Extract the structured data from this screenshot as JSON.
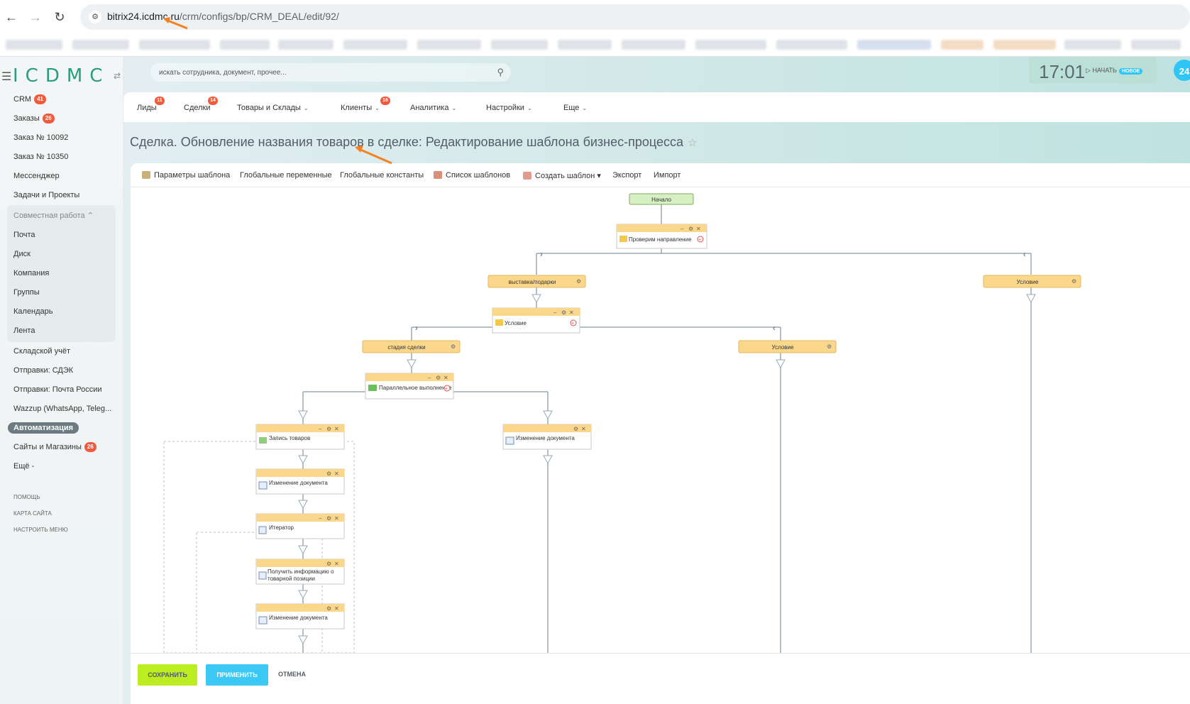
{
  "browser": {
    "url_domain": "bitrix24.icdmc.ru",
    "url_path": "/crm/configs/bp/CRM_DEAL/edit/92/"
  },
  "header": {
    "logo": "ICDMC",
    "search_placeholder": "искать сотрудника, документ, прочее...",
    "clock": "17:01",
    "start_label": "НАЧАТЬ",
    "new_badge": "НОВОЕ",
    "b24_label": "24"
  },
  "sidebar": {
    "items": [
      {
        "label": "CRM",
        "badge": "41"
      },
      {
        "label": "Заказы",
        "badge": "26"
      },
      {
        "label": "Заказ № 10092"
      },
      {
        "label": "Заказ № 10350"
      },
      {
        "label": "Мессенджер"
      },
      {
        "label": "Задачи и Проекты"
      }
    ],
    "group_title": "Совместная работа",
    "group_items": [
      "Почта",
      "Диск",
      "Компания",
      "Группы",
      "Календарь",
      "Лента"
    ],
    "items2": [
      {
        "label": "Складской учёт"
      },
      {
        "label": "Отправки: СДЭК"
      },
      {
        "label": "Отправки: Почта России"
      },
      {
        "label": "Wazzup (WhatsApp, Teleg..."
      },
      {
        "label": "Автоматизация",
        "active": true
      },
      {
        "label": "Сайты и Магазины",
        "badge": "26"
      },
      {
        "label": "Ещё -"
      }
    ],
    "footer_links": [
      "ПОМОЩЬ",
      "КАРТА САЙТА",
      "НАСТРОИТЬ МЕНЮ"
    ]
  },
  "topnav": {
    "tabs": [
      {
        "label": "Лиды",
        "badge": "11"
      },
      {
        "label": "Сделки",
        "badge": "14"
      },
      {
        "label": "Товары и Склады",
        "chevron": true
      },
      {
        "label": "Клиенты",
        "badge": "16",
        "chevron": true
      },
      {
        "label": "Аналитика",
        "chevron": true
      },
      {
        "label": "Настройки",
        "chevron": true
      },
      {
        "label": "Еще",
        "chevron": true
      }
    ]
  },
  "page": {
    "title": "Сделка. Обновление названия товаров в сделке: Редактирование шаблона бизнес-процесса"
  },
  "toolbar": {
    "items": [
      "Параметры шаблона",
      "Глобальные переменные",
      "Глобальные константы",
      "Список шаблонов",
      "Создать шаблон",
      "Экспорт",
      "Импорт"
    ]
  },
  "workflow": {
    "start": "Начало",
    "condition1": "Проверим направление",
    "branch_exhibition": "выставка/подарки",
    "branch_condition_right": "Условие",
    "condition2": "Условие",
    "branch_deal_stage": "стадия сделки",
    "branch_condition_mid": "Условие",
    "parallel": "Параллельное выполнение",
    "record_goods": "Запись товаров",
    "doc_change_right": "Изменение документа",
    "doc_change_1": "Изменение документа",
    "iterator": "Итератор",
    "get_product_info": "Получить информацию о товарной позиции",
    "doc_change_2": "Изменение документа"
  },
  "footer": {
    "save": "СОХРАНИТЬ",
    "apply": "ПРИМЕНИТЬ",
    "cancel": "ОТМЕНА"
  },
  "colors": {
    "accent_orange": "#f5821f",
    "block_header": "#fbd78b",
    "start_green": "#d6f0c4",
    "save_green": "#bbed21",
    "apply_blue": "#3bc8f5",
    "badge_red": "#f25a3d"
  }
}
